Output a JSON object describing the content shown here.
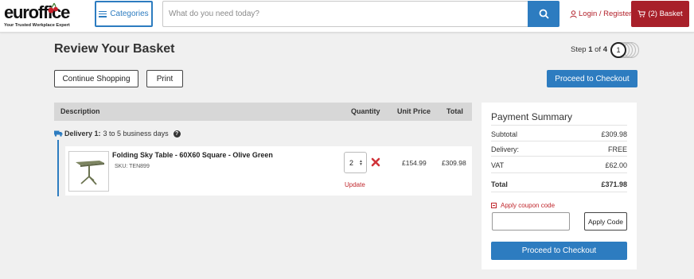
{
  "header": {
    "logo_text": "euroffice",
    "logo_tagline": "Your Trusted Workplace Expert",
    "categories_label": "Categories",
    "search_placeholder": "What do you need today?",
    "login_label": "Login / Register",
    "basket_label": "(2) Basket",
    "colors": {
      "brand_red": "#a8202a",
      "accent_blue": "#2d7cc0"
    }
  },
  "page": {
    "title": "Review Your Basket",
    "step_prefix": "Step",
    "step_current": "1",
    "step_of": "of",
    "step_total": "4",
    "step_circle": "1"
  },
  "actions": {
    "continue_label": "Continue Shopping",
    "print_label": "Print",
    "checkout_label": "Proceed to Checkout"
  },
  "table": {
    "headers": {
      "description": "Description",
      "quantity": "Quantity",
      "unit_price": "Unit Price",
      "total": "Total"
    }
  },
  "delivery": {
    "label": "Delivery 1:",
    "text": "3 to 5 business days",
    "help_icon": "?"
  },
  "items": [
    {
      "name": "Folding Sky Table - 60X60 Square - Olive Green",
      "sku": "SKU: TEN899",
      "quantity": "2",
      "update_label": "Update",
      "unit_price": "£154.99",
      "total": "£309.98",
      "thumbnail": "olive-green-folding-table"
    }
  ],
  "summary": {
    "title": "Payment Summary",
    "rows": [
      {
        "label": "Subtotal",
        "value": "£309.98"
      },
      {
        "label": "Delivery:",
        "value": "FREE"
      },
      {
        "label": "VAT",
        "value": "£62.00"
      },
      {
        "label": "Total",
        "value": "£371.98"
      }
    ],
    "coupon_label": "Apply coupon code",
    "coupon_value": "",
    "apply_label": "Apply Code",
    "checkout_label": "Proceed to Checkout"
  }
}
